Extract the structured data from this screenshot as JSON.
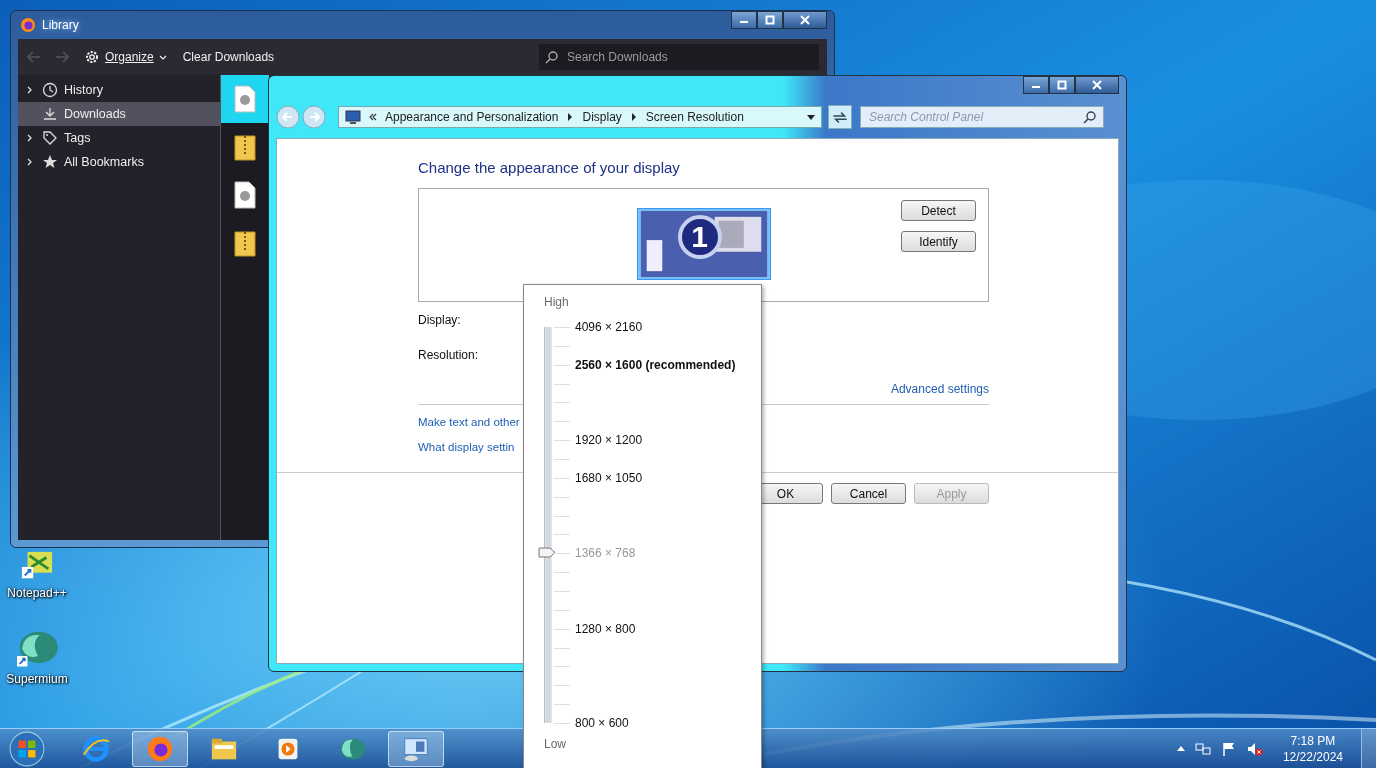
{
  "library_window": {
    "title": "Library",
    "organize": "Organize",
    "clear_downloads": "Clear Downloads",
    "search_placeholder": "Search Downloads",
    "sidebar": [
      {
        "label": "History",
        "selected": false,
        "expandable": true
      },
      {
        "label": "Downloads",
        "selected": true,
        "expandable": false
      },
      {
        "label": "Tags",
        "selected": false,
        "expandable": true
      },
      {
        "label": "All Bookmarks",
        "selected": false,
        "expandable": true
      }
    ],
    "downloads": [
      {
        "kind": "document",
        "selected": true
      },
      {
        "kind": "archive",
        "selected": false
      },
      {
        "kind": "document",
        "selected": false
      },
      {
        "kind": "archive",
        "selected": false
      }
    ]
  },
  "control_panel": {
    "breadcrumb": [
      "Appearance and Personalization",
      "Display",
      "Screen Resolution"
    ],
    "search_placeholder": "Search Control Panel",
    "heading": "Change the appearance of your display",
    "monitor_number": "1",
    "side_buttons": [
      "Detect",
      "Identify"
    ],
    "fields": [
      "Display:",
      "Resolution:"
    ],
    "advanced_link": "Advanced settings",
    "links": [
      "Make text and other",
      "What display settin"
    ],
    "dialog_buttons": [
      {
        "label": "OK",
        "disabled": false
      },
      {
        "label": "Cancel",
        "disabled": false
      },
      {
        "label": "Apply",
        "disabled": true
      }
    ]
  },
  "resolution_dropdown": {
    "high": "High",
    "low": "Low",
    "level": 0.43,
    "options": [
      {
        "label": "4096 × 2160",
        "recommended": false,
        "selected": false
      },
      {
        "label": "2560 × 1600 (recommended)",
        "recommended": true,
        "selected": false
      },
      {
        "label": "1920 × 1200",
        "recommended": false,
        "selected": false
      },
      {
        "label": "1680 × 1050",
        "recommended": false,
        "selected": false
      },
      {
        "label": "1366 × 768",
        "recommended": false,
        "selected": true
      },
      {
        "label": "1280 × 800",
        "recommended": false,
        "selected": false
      },
      {
        "label": "800 × 600",
        "recommended": false,
        "selected": false
      }
    ]
  },
  "desktop_icons": [
    {
      "label": "Notepad++"
    },
    {
      "label": "Supermium"
    }
  ],
  "taskbar": {
    "items": [
      {
        "selected": false
      },
      {
        "selected": true
      },
      {
        "selected": false
      },
      {
        "selected": false
      },
      {
        "selected": false
      },
      {
        "selected": true
      }
    ],
    "time": "7:18 PM",
    "date": "12/22/2024"
  }
}
